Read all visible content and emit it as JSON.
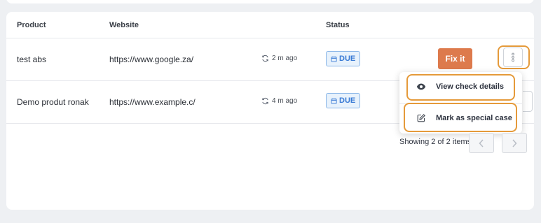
{
  "table": {
    "headers": {
      "product": "Product",
      "website": "Website",
      "status": "Status"
    },
    "rows": [
      {
        "product": "test abs",
        "website": "https://www.google.za/",
        "updated": "2 m ago",
        "status": "DUE",
        "action": "Fix it"
      },
      {
        "product": "Demo produt ronak",
        "website": "https://www.example.c/",
        "updated": "4 m ago",
        "status": "DUE"
      }
    ]
  },
  "menu": {
    "items": [
      {
        "label": "View check details",
        "icon": "eye-icon"
      },
      {
        "label": "Mark as special case",
        "icon": "edit-icon"
      }
    ]
  },
  "pagination": {
    "summary": "Showing 2 of 2 items",
    "prev_icon": "chevron-left-icon",
    "next_icon": "chevron-right-icon"
  },
  "colors": {
    "accent": "#dd7a4c",
    "highlight": "#e59a3a",
    "badge_text": "#3a7bd5",
    "badge_bg": "#e8f2fc"
  }
}
